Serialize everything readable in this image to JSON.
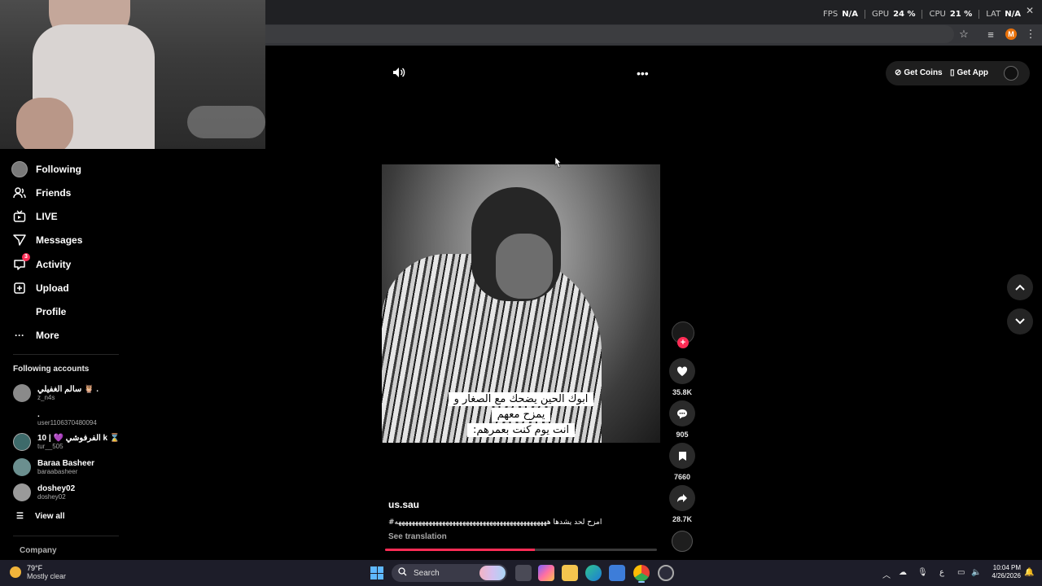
{
  "overlay": {
    "fps_label": "FPS",
    "fps_value": "N/A",
    "gpu_label": "GPU",
    "gpu_value": "24 %",
    "cpu_label": "CPU",
    "cpu_value": "21 %",
    "lat_label": "LAT",
    "lat_value": "N/A"
  },
  "sidebar": {
    "items": [
      {
        "label": "Following",
        "icon": "following-avatar-icon"
      },
      {
        "label": "Friends",
        "icon": "friends-icon"
      },
      {
        "label": "LIVE",
        "icon": "live-tv-icon"
      },
      {
        "label": "Messages",
        "icon": "send-icon"
      },
      {
        "label": "Activity",
        "icon": "activity-icon",
        "badge": "3"
      },
      {
        "label": "Upload",
        "icon": "plus-square-icon"
      },
      {
        "label": "Profile",
        "icon": "profile-icon"
      },
      {
        "label": "More",
        "icon": "more-dots-icon"
      }
    ],
    "following_title": "Following accounts",
    "accounts": [
      {
        "name": "سالم الغفيلي 🦉 .",
        "handle": "z_n4s"
      },
      {
        "name": ".",
        "handle": "user1106370480094"
      },
      {
        "name": "10 | 💜 الفرفوشي k ⌛",
        "handle": "tur__505"
      },
      {
        "name": "Baraa Basheer",
        "handle": "baraabasheer"
      },
      {
        "name": "doshey02",
        "handle": "doshey02"
      }
    ],
    "view_all": "View all",
    "company": "Company"
  },
  "video": {
    "caption_lines": [
      "ابوك الحين يضحك مع الصغار و",
      "يمزح معهم",
      "انت يوم كنت بعمرهم:"
    ],
    "progress": 0.55
  },
  "actions": {
    "likes": "35.8K",
    "comments": "905",
    "saves": "7660",
    "shares": "28.7K"
  },
  "info": {
    "author": "us.sau",
    "description": "#امزح لحد يشدها هههههههههههههههههههههههههههههههههههههههههههههه",
    "see_translation": "See translation"
  },
  "header": {
    "get_coins": "Get Coins",
    "get_app": "Get App"
  },
  "taskbar": {
    "weather_temp": "79°F",
    "weather_desc": "Mostly clear",
    "search_label": "Search",
    "lang": "ع",
    "time": "10:04 PM",
    "date": "4/26/2026"
  },
  "colors": {
    "accent": "#fe2c55",
    "background": "#000000",
    "taskbar": "#1d1d29"
  }
}
